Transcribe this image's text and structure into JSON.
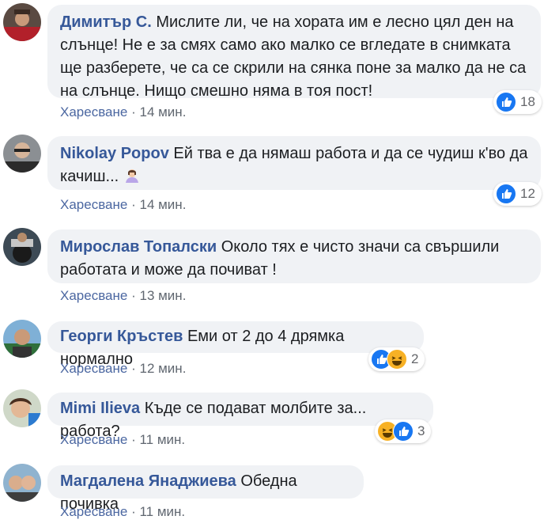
{
  "comments": [
    {
      "author": "Димитър С.",
      "text": "Мислите ли, че на хората им е лесно цял ден на слънце! Не е за смях само ако малко се вгледате в снимката ще разберете, че са се скрили на сянка поне за малко да не са на слънце. Нищо смешно няма в тоя пост!",
      "like_label": "Харесване",
      "separator": "·",
      "time": "14 мин.",
      "reactions": [
        "like"
      ],
      "reaction_count": "18"
    },
    {
      "author": "Nikolay Popov",
      "text": "Ей тва е да нямаш работа и да се чудиш к'во да качиш...",
      "emoji": "woman-shrugging",
      "like_label": "Харесване",
      "separator": "·",
      "time": "14 мин.",
      "reactions": [
        "like"
      ],
      "reaction_count": "12"
    },
    {
      "author": "Мирослав Топалски",
      "text": "Около тях е чисто значи са свършили работата и може да почиват !",
      "like_label": "Харесване",
      "separator": "·",
      "time": "13 мин."
    },
    {
      "author": "Георги Кръстев",
      "text": "Еми от 2 до 4 дрямка нормално",
      "like_label": "Харесване",
      "separator": "·",
      "time": "12 мин.",
      "reactions": [
        "like",
        "haha"
      ],
      "reaction_count": "2"
    },
    {
      "author": "Mimi Ilieva",
      "text": "Къде се подават молбите за... работа?",
      "like_label": "Харесване",
      "separator": "·",
      "time": "11 мин.",
      "reactions": [
        "haha",
        "like"
      ],
      "reaction_count": "3"
    },
    {
      "author": "Магдалена Янаджиева",
      "text": "Обедна почивка",
      "like_label": "Харесване",
      "separator": "·",
      "time": "11 мин."
    }
  ],
  "colors": {
    "author": "#365899",
    "bubble": "#f0f2f5",
    "like": "#1877f2",
    "haha": "#f7b125"
  }
}
